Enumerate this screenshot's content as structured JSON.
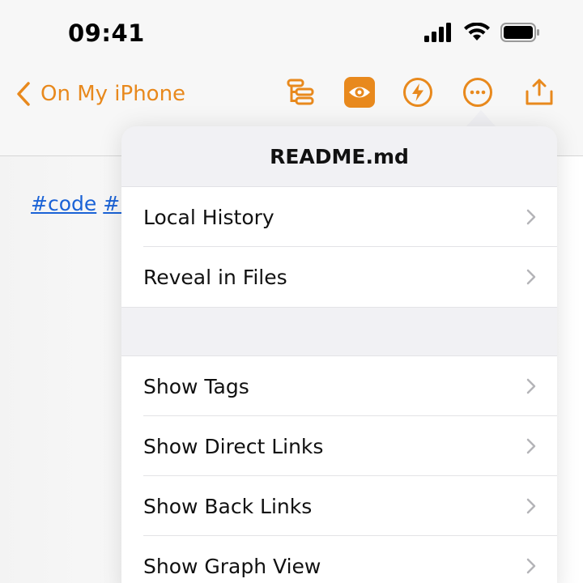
{
  "status_bar": {
    "time": "09:41"
  },
  "nav": {
    "back_label": "On My iPhone",
    "accent_color": "#e8891d",
    "icons": [
      "outline-icon",
      "preview-eye-icon",
      "lightning-icon",
      "more-ellipsis-icon",
      "share-icon"
    ]
  },
  "document": {
    "tags": [
      "#code",
      "#i"
    ]
  },
  "menu": {
    "title": "README.md",
    "group1": [
      {
        "label": "Local History"
      },
      {
        "label": "Reveal in Files"
      }
    ],
    "group2": [
      {
        "label": "Show Tags"
      },
      {
        "label": "Show Direct Links"
      },
      {
        "label": "Show Back Links"
      },
      {
        "label": "Show Graph View"
      }
    ]
  }
}
